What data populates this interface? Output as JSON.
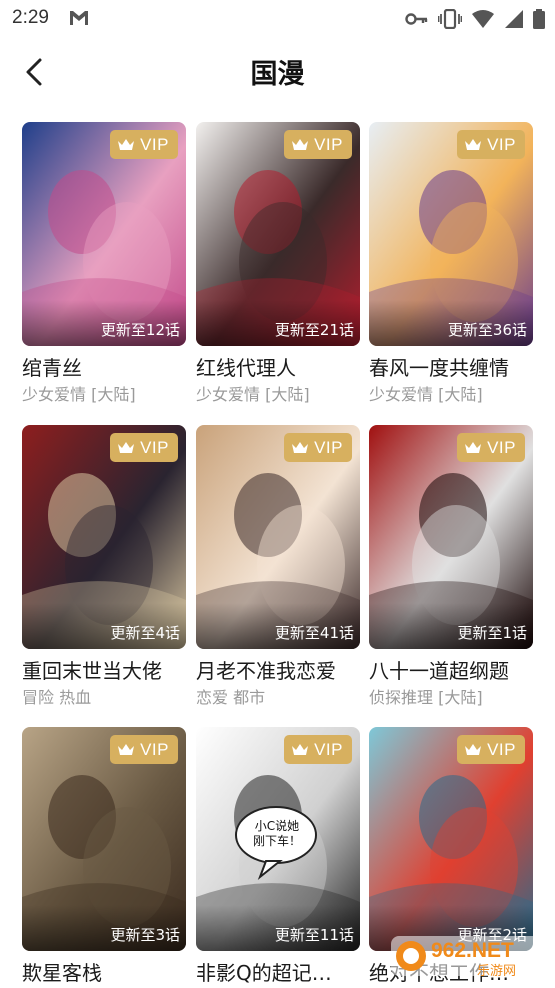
{
  "status": {
    "time": "2:29"
  },
  "header": {
    "title": "国漫"
  },
  "items": [
    {
      "title": "绾青丝",
      "tags": "少女爱情 [大陆]",
      "update": "更新至12话",
      "vip": "VIP",
      "colors": [
        "#1f3f8a",
        "#c24a8a",
        "#e8a0c0"
      ]
    },
    {
      "title": "红线代理人",
      "tags": "少女爱情 [大陆]",
      "update": "更新至21话",
      "vip": "VIP",
      "colors": [
        "#f2f0ee",
        "#b21e2e",
        "#3a2a2a"
      ]
    },
    {
      "title": "春风一度共缠情",
      "tags": "少女爱情 [大陆]",
      "update": "更新至36话",
      "vip": "VIP",
      "colors": [
        "#e7eef4",
        "#6a3d8c",
        "#f2b35a"
      ]
    },
    {
      "title": "重回末世当大佬",
      "tags": "冒险 热血",
      "update": "更新至4话",
      "vip": "VIP",
      "colors": [
        "#8e1e1e",
        "#d8c6a0",
        "#2a2430"
      ]
    },
    {
      "title": "月老不准我恋爱",
      "tags": "恋爱 都市",
      "update": "更新至41话",
      "vip": "VIP",
      "colors": [
        "#c9a27a",
        "#3b2a2a",
        "#f3e3d3"
      ]
    },
    {
      "title": "八十一道超纲题",
      "tags": "侦探推理 [大陆]",
      "update": "更新至1话",
      "vip": "VIP",
      "colors": [
        "#a01010",
        "#1a0808",
        "#e0e0e0"
      ]
    },
    {
      "title": "欺星客栈",
      "tags": "",
      "update": "更新至3话",
      "vip": "VIP",
      "colors": [
        "#b8a486",
        "#3a2a1e",
        "#6a5a44"
      ]
    },
    {
      "title": "非影Q的超记…",
      "tags": "",
      "update": "更新至11话",
      "vip": "VIP",
      "colors": [
        "#ffffff",
        "#222222",
        "#d0d0d0"
      ],
      "bubble": "小C说她\n刚下车！"
    },
    {
      "title": "绝对不想工作…",
      "tags": "",
      "update": "更新至2话",
      "vip": "VIP",
      "colors": [
        "#7ec8d8",
        "#2a6a8a",
        "#e04030"
      ]
    }
  ],
  "watermark": {
    "text": "962.NET",
    "sub": "乐游网"
  }
}
